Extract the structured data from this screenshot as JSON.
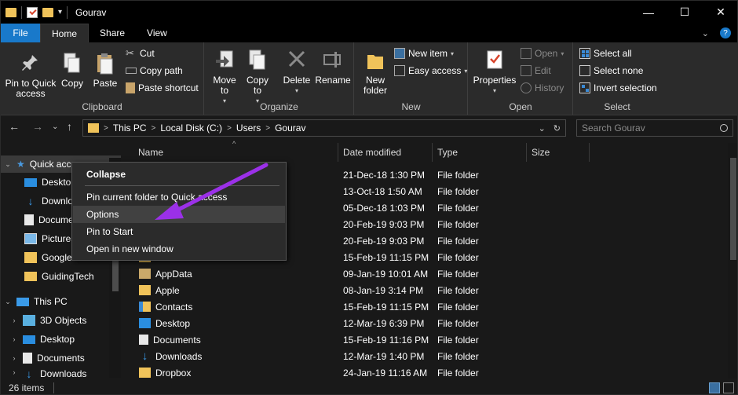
{
  "window": {
    "title": "Gourav",
    "minimize": "—",
    "maximize": "☐",
    "close": "✕"
  },
  "ribbon_tabs": {
    "file": "File",
    "home": "Home",
    "share": "Share",
    "view": "View",
    "expand": "⌄",
    "help": "?"
  },
  "clipboard": {
    "label": "Clipboard",
    "pin": "Pin to Quick access",
    "copy": "Copy",
    "paste": "Paste",
    "cut": "Cut",
    "copy_path": "Copy path",
    "paste_shortcut": "Paste shortcut"
  },
  "organize": {
    "label": "Organize",
    "move_to": "Move to",
    "copy_to": "Copy to",
    "delete": "Delete",
    "rename": "Rename"
  },
  "new_group": {
    "label": "New",
    "new_folder": "New folder",
    "new_item": "New item",
    "easy_access": "Easy access"
  },
  "open_group": {
    "label": "Open",
    "properties": "Properties",
    "open": "Open",
    "edit": "Edit",
    "history": "History"
  },
  "select_group": {
    "label": "Select",
    "select_all": "Select all",
    "select_none": "Select none",
    "invert": "Invert selection"
  },
  "address": {
    "crumbs": [
      "This PC",
      "Local Disk (C:)",
      "Users",
      "Gourav"
    ],
    "separator": ">",
    "dropdown": "⌄",
    "refresh": "↻"
  },
  "search": {
    "placeholder": "Search Gourav"
  },
  "nav_pane": {
    "quick_access": "Quick access",
    "items": [
      "Desktop",
      "Downloads",
      "Documents",
      "Pictures",
      "Google Drive",
      "GuidingTech"
    ],
    "this_pc": "This PC",
    "pc_items": [
      "3D Objects",
      "Desktop",
      "Documents",
      "Downloads"
    ]
  },
  "columns": {
    "name": "Name",
    "date": "Date modified",
    "type": "Type",
    "size": "Size"
  },
  "files": [
    {
      "name": "",
      "date": "21-Dec-18 1:30 PM",
      "type": "File folder"
    },
    {
      "name": "",
      "date": "13-Oct-18 1:50 AM",
      "type": "File folder"
    },
    {
      "name": "",
      "date": "05-Dec-18 1:03 PM",
      "type": "File folder"
    },
    {
      "name": "",
      "date": "20-Feb-19 9:03 PM",
      "type": "File folder"
    },
    {
      "name": "",
      "date": "20-Feb-19 9:03 PM",
      "type": "File folder"
    },
    {
      "name": "",
      "date": "15-Feb-19 11:15 PM",
      "type": "File folder"
    },
    {
      "name": "AppData",
      "date": "09-Jan-19 10:01 AM",
      "type": "File folder"
    },
    {
      "name": "Apple",
      "date": "08-Jan-19 3:14 PM",
      "type": "File folder"
    },
    {
      "name": "Contacts",
      "date": "15-Feb-19 11:15 PM",
      "type": "File folder"
    },
    {
      "name": "Desktop",
      "date": "12-Mar-19 6:39 PM",
      "type": "File folder"
    },
    {
      "name": "Documents",
      "date": "15-Feb-19 11:16 PM",
      "type": "File folder"
    },
    {
      "name": "Downloads",
      "date": "12-Mar-19 1:40 PM",
      "type": "File folder"
    },
    {
      "name": "Dropbox",
      "date": "24-Jan-19 11:16 AM",
      "type": "File folder"
    }
  ],
  "context_menu": {
    "collapse": "Collapse",
    "pin_quick": "Pin current folder to Quick access",
    "options": "Options",
    "pin_start": "Pin to Start",
    "open_new": "Open in new window"
  },
  "status": {
    "items": "26 items"
  },
  "colors": {
    "accent": "#1979ca",
    "folder": "#f0c35a",
    "arrow": "#9b30e8"
  }
}
